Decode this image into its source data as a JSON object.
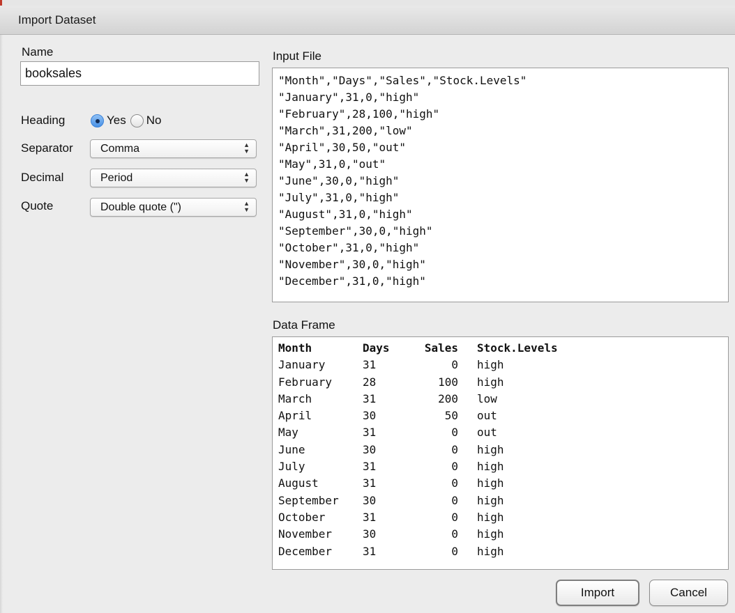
{
  "window": {
    "title": "Import Dataset"
  },
  "name": {
    "label": "Name",
    "value": "booksales"
  },
  "heading": {
    "label": "Heading",
    "options": [
      {
        "label": "Yes",
        "checked": true
      },
      {
        "label": "No",
        "checked": false
      }
    ]
  },
  "separator": {
    "label": "Separator",
    "value": "Comma"
  },
  "decimal": {
    "label": "Decimal",
    "value": "Period"
  },
  "quote": {
    "label": "Quote",
    "value": "Double quote (\")"
  },
  "input_file": {
    "label": "Input File",
    "lines": [
      "\"Month\",\"Days\",\"Sales\",\"Stock.Levels\"",
      "\"January\",31,0,\"high\"",
      "\"February\",28,100,\"high\"",
      "\"March\",31,200,\"low\"",
      "\"April\",30,50,\"out\"",
      "\"May\",31,0,\"out\"",
      "\"June\",30,0,\"high\"",
      "\"July\",31,0,\"high\"",
      "\"August\",31,0,\"high\"",
      "\"September\",30,0,\"high\"",
      "\"October\",31,0,\"high\"",
      "\"November\",30,0,\"high\"",
      "\"December\",31,0,\"high\""
    ]
  },
  "data_frame": {
    "label": "Data Frame",
    "columns": [
      "Month",
      "Days",
      "Sales",
      "Stock.Levels"
    ],
    "rows": [
      [
        "January",
        "31",
        "0",
        "high"
      ],
      [
        "February",
        "28",
        "100",
        "high"
      ],
      [
        "March",
        "31",
        "200",
        "low"
      ],
      [
        "April",
        "30",
        "50",
        "out"
      ],
      [
        "May",
        "31",
        "0",
        "out"
      ],
      [
        "June",
        "30",
        "0",
        "high"
      ],
      [
        "July",
        "31",
        "0",
        "high"
      ],
      [
        "August",
        "31",
        "0",
        "high"
      ],
      [
        "September",
        "30",
        "0",
        "high"
      ],
      [
        "October",
        "31",
        "0",
        "high"
      ],
      [
        "November",
        "30",
        "0",
        "high"
      ],
      [
        "December",
        "31",
        "0",
        "high"
      ]
    ]
  },
  "buttons": {
    "import": "Import",
    "cancel": "Cancel"
  }
}
